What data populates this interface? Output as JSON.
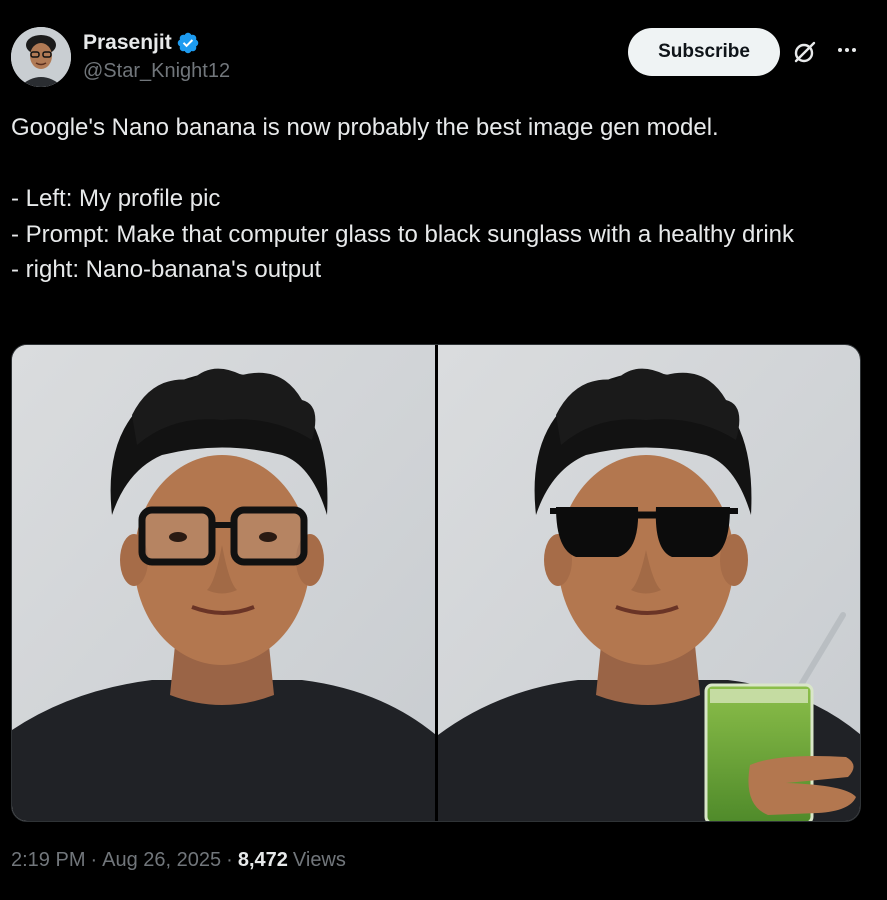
{
  "author": {
    "display_name": "Prasenjit",
    "handle": "@Star_Knight12",
    "verified": true,
    "avatar_icon": "profile-photo"
  },
  "actions": {
    "subscribe_label": "Subscribe",
    "grok_icon": "grok-icon",
    "more_icon": "more-icon"
  },
  "tweet": {
    "lines": [
      "Google's Nano banana is now probably the best image gen model.",
      "",
      "- Left: My profile pic",
      "- Prompt: Make that computer glass to black sunglass with a healthy drink",
      "- right: Nano-banana's output"
    ]
  },
  "media": {
    "left_image": "original profile photo with clear computer glasses",
    "right_image": "edited photo with black sunglasses holding green drink"
  },
  "meta": {
    "time": "2:19 PM",
    "separator": "·",
    "date": "Aug 26, 2025",
    "views_count": "8,472",
    "views_label": "Views"
  },
  "colors": {
    "background": "#000000",
    "text_primary": "#e7e9ea",
    "text_secondary": "#71767b",
    "verified_blue": "#1d9bf0",
    "subscribe_bg": "#eff3f4"
  }
}
